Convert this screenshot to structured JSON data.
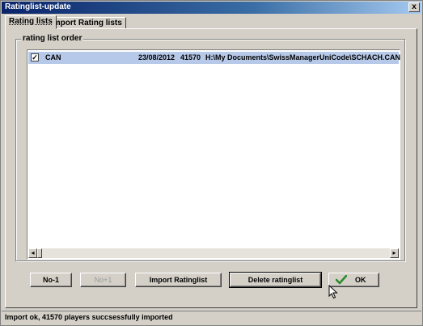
{
  "window": {
    "title": "Ratinglist-update",
    "close_label": "x"
  },
  "tabs": [
    {
      "label": "Rating lists",
      "active": true
    },
    {
      "label": "Import Rating lists",
      "active": false
    }
  ],
  "group": {
    "label": "rating list order"
  },
  "rating_lists": [
    {
      "checked": true,
      "check_glyph": "✓",
      "name": "CAN",
      "date": "23/08/2012",
      "count": "41570",
      "path": "H:\\My Documents\\SwissManagerUniCode\\SCHACH.CAN"
    }
  ],
  "scrollbar": {
    "left_glyph": "◂",
    "right_glyph": "▸"
  },
  "buttons": {
    "no_minus_1": "No-1",
    "no_plus_1": "No+1",
    "import": "Import Ratinglist",
    "delete": "Delete ratinglist",
    "ok": "OK"
  },
  "status": {
    "text": "Import ok, 41570 players succsessfully imported"
  },
  "colors": {
    "title_gradient_start": "#0a246a",
    "selection": "#b7c9e8",
    "ok_check": "#2e8b2e"
  }
}
